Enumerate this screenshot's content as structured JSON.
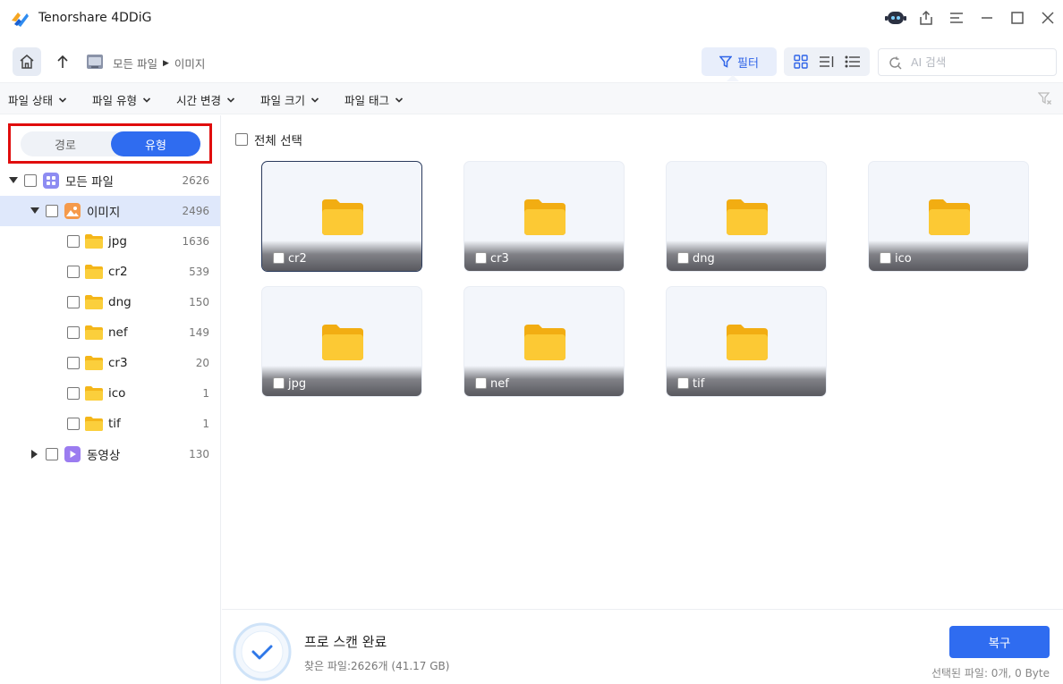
{
  "app": {
    "title": "Tenorshare 4DDiG"
  },
  "nav": {
    "breadcrumb": [
      "모든 파일",
      "이미지"
    ],
    "filter_label": "필터",
    "search_placeholder": "AI 검색"
  },
  "filters": [
    "파일 상태",
    "파일 유형",
    "시간 변경",
    "파일 크기",
    "파일 태그"
  ],
  "sidebar": {
    "toggle": {
      "path": "경로",
      "type": "유형",
      "selected": "유형"
    },
    "tree": {
      "all": {
        "label": "모든 파일",
        "count": "2626"
      },
      "images": {
        "label": "이미지",
        "count": "2496"
      },
      "children": [
        {
          "label": "jpg",
          "count": "1636"
        },
        {
          "label": "cr2",
          "count": "539"
        },
        {
          "label": "dng",
          "count": "150"
        },
        {
          "label": "nef",
          "count": "149"
        },
        {
          "label": "cr3",
          "count": "20"
        },
        {
          "label": "ico",
          "count": "1"
        },
        {
          "label": "tif",
          "count": "1"
        }
      ],
      "video": {
        "label": "동영상",
        "count": "130"
      }
    }
  },
  "main": {
    "select_all": "전체 선택",
    "cards": [
      {
        "name": "cr2"
      },
      {
        "name": "cr3"
      },
      {
        "name": "dng"
      },
      {
        "name": "ico"
      },
      {
        "name": "jpg"
      },
      {
        "name": "nef"
      },
      {
        "name": "tif"
      }
    ]
  },
  "bottom": {
    "title": "프로 스캔 완료",
    "found": "찾은 파일:2626개 (41.17 GB)",
    "recover_label": "복구",
    "selected_info": "선택된 파일: 0개, 0 Byte"
  },
  "colors": {
    "accent": "#2f6cf0",
    "highlight_box": "#e00d0d",
    "folder": "#f7c22e"
  }
}
